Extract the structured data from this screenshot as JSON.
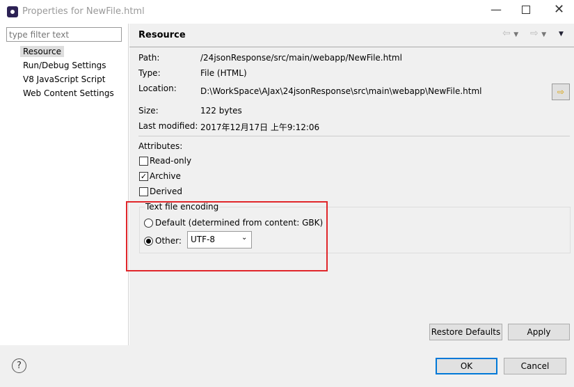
{
  "window": {
    "title": "Properties for NewFile.html"
  },
  "sidebar": {
    "filter_placeholder": "type filter text",
    "items": [
      {
        "label": "Resource",
        "selected": true
      },
      {
        "label": "Run/Debug Settings"
      },
      {
        "label": "V8 JavaScript Script"
      },
      {
        "label": "Web Content Settings"
      }
    ]
  },
  "page": {
    "title": "Resource",
    "path_label": "Path:",
    "path": "/24jsonResponse/src/main/webapp/NewFile.html",
    "type_label": "Type:",
    "type": "File  (HTML)",
    "location_label": "Location:",
    "location": "D:\\WorkSpace\\AJax\\24jsonResponse\\src\\main\\webapp\\NewFile.html",
    "size_label": "Size:",
    "size": "122  bytes",
    "modified_label": "Last modified:",
    "modified": "2017年12月17日 上午9:12:06",
    "attributes_label": "Attributes:",
    "readonly": "Read-only",
    "archive": "Archive",
    "derived": "Derived",
    "encoding_group": "Text file encoding",
    "default_option": "Default (determined from content: GBK)",
    "other_option": "Other:",
    "encoding_value": "UTF-8",
    "restore": "Restore Defaults",
    "apply": "Apply"
  },
  "footer": {
    "ok": "OK",
    "cancel": "Cancel",
    "help": "?"
  },
  "colors": {
    "highlight": "#e0262a",
    "ok_border": "#0078d7"
  }
}
